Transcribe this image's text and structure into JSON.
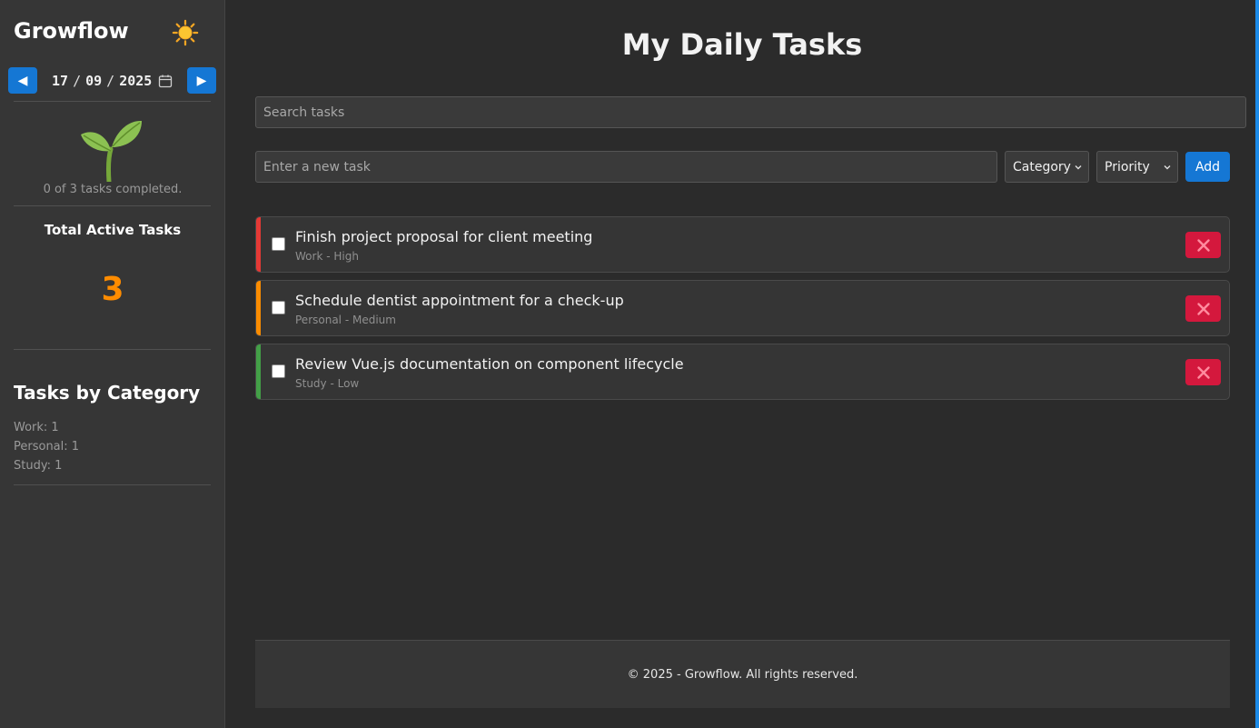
{
  "app": {
    "brand": "Growflow",
    "theme_icon": "sun-icon"
  },
  "date_nav": {
    "prev_icon": "◀",
    "next_icon": "▶",
    "day": "17",
    "month": "09",
    "year": "2025"
  },
  "sidebar": {
    "progress_text": "0 of 3 tasks completed.",
    "active_title": "Total Active Tasks",
    "active_count": "3",
    "category_title": "Tasks by Category",
    "categories": [
      "Work: 1",
      "Personal: 1",
      "Study: 1"
    ]
  },
  "main": {
    "title": "My Daily Tasks",
    "search_placeholder": "Search tasks",
    "new_task_placeholder": "Enter a new task",
    "category_select": "Category",
    "priority_select": "Priority",
    "add_label": "Add"
  },
  "tasks": [
    {
      "title": "Finish project proposal for client meeting",
      "meta": "Work - High",
      "priority_color": "#e53935",
      "completed": false
    },
    {
      "title": "Schedule dentist appointment for a check-up",
      "meta": "Personal - Medium",
      "priority_color": "#fb8c00",
      "completed": false
    },
    {
      "title": "Review Vue.js documentation on component lifecycle",
      "meta": "Study - Low",
      "priority_color": "#43a047",
      "completed": false
    }
  ],
  "footer": {
    "text": "© 2025 - Growflow. All rights reserved."
  },
  "colors": {
    "accent": "#1577d4",
    "count": "#ff8c00",
    "delete": "#d4183d"
  }
}
